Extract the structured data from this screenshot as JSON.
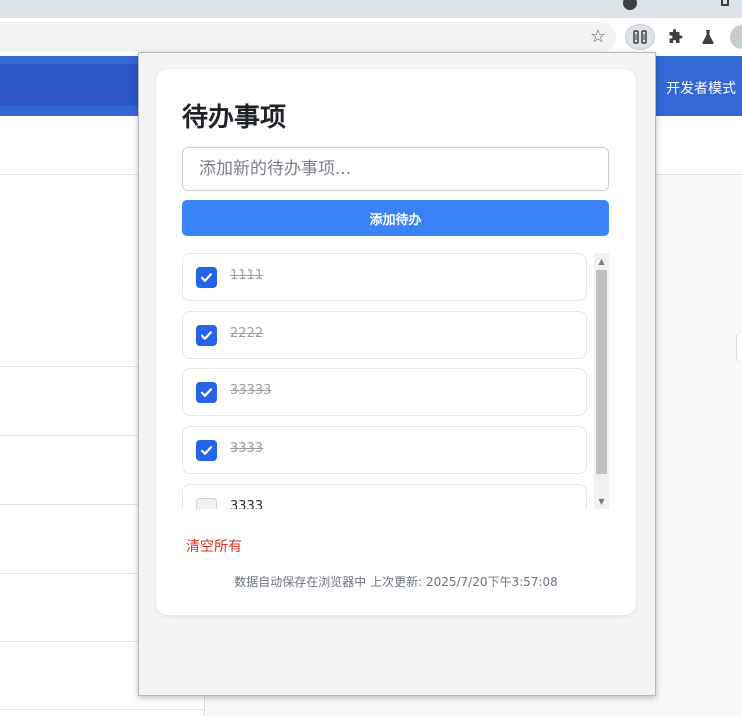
{
  "browser": {
    "icons": [
      "star-icon",
      "extension-active-icon",
      "puzzle-icon",
      "flask-icon",
      "avatar"
    ]
  },
  "background_page": {
    "header_right": "开发者模式"
  },
  "popup": {
    "title": "待办事项",
    "input_placeholder": "添加新的待办事项...",
    "input_value": "",
    "add_button": "添加待办",
    "todos": [
      {
        "text": "1111",
        "done": true
      },
      {
        "text": "2222",
        "done": true
      },
      {
        "text": "33333",
        "done": true
      },
      {
        "text": "3333",
        "done": true
      },
      {
        "text": "3333",
        "done": false
      }
    ],
    "clear_all": "清空所有",
    "footer": "数据自动保存在浏览器中 上次更新: 2025/7/20下午3:57:08"
  },
  "colors": {
    "accent": "#3b82f6",
    "checkbox_checked": "#2563eb",
    "danger": "#d93025",
    "header_bg": "#3367d6"
  }
}
